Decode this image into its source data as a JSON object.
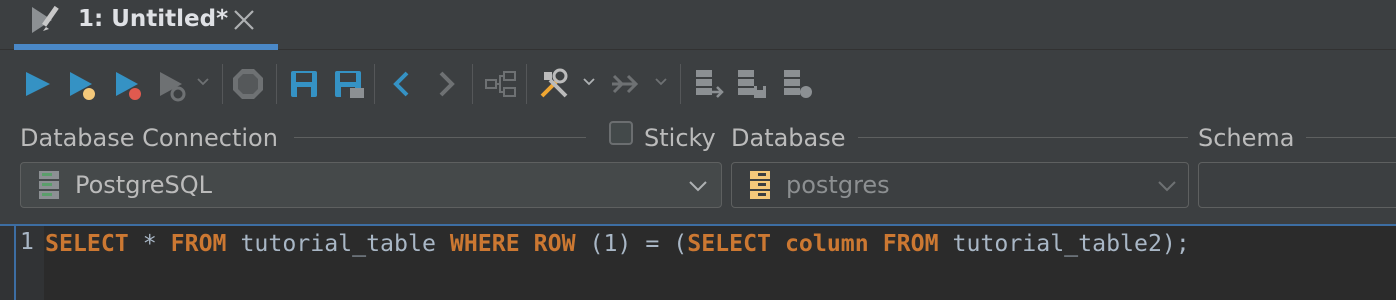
{
  "tab": {
    "title": "1: Untitled*"
  },
  "toolbar": {
    "buttons": [
      "run-icon",
      "run-with-params-icon",
      "run-profile-icon",
      "run-more-icon",
      "stop-icon",
      "save-icon",
      "save-as-icon",
      "back-icon",
      "forward-icon",
      "explain-plan-icon",
      "tools-icon",
      "format-icon",
      "commit-icon",
      "rollback-icon",
      "transaction-icon"
    ]
  },
  "labels": {
    "connection": "Database Connection",
    "sticky": "Sticky",
    "database": "Database",
    "schema": "Schema"
  },
  "combos": {
    "connection": {
      "value": "PostgreSQL"
    },
    "database": {
      "value": "postgres"
    },
    "schema": {
      "value": ""
    }
  },
  "editor": {
    "line_number": "1",
    "tokens": [
      {
        "t": "SELECT",
        "k": "kw"
      },
      {
        "t": " * ",
        "k": "txt"
      },
      {
        "t": "FROM",
        "k": "kw"
      },
      {
        "t": " tutorial_table ",
        "k": "txt"
      },
      {
        "t": "WHERE",
        "k": "kw"
      },
      {
        "t": " ",
        "k": "txt"
      },
      {
        "t": "ROW",
        "k": "kw"
      },
      {
        "t": " (1) = (",
        "k": "txt"
      },
      {
        "t": "SELECT",
        "k": "kw"
      },
      {
        "t": " ",
        "k": "txt"
      },
      {
        "t": "column",
        "k": "kw"
      },
      {
        "t": " ",
        "k": "txt"
      },
      {
        "t": "FROM",
        "k": "kw"
      },
      {
        "t": " tutorial_table2);",
        "k": "txt"
      }
    ]
  },
  "colors": {
    "accent": "#4a88c7",
    "keyword": "#cc7832",
    "text": "#a9b7c6",
    "background": "#3c3f41",
    "editor_bg": "#2b2b2b"
  }
}
